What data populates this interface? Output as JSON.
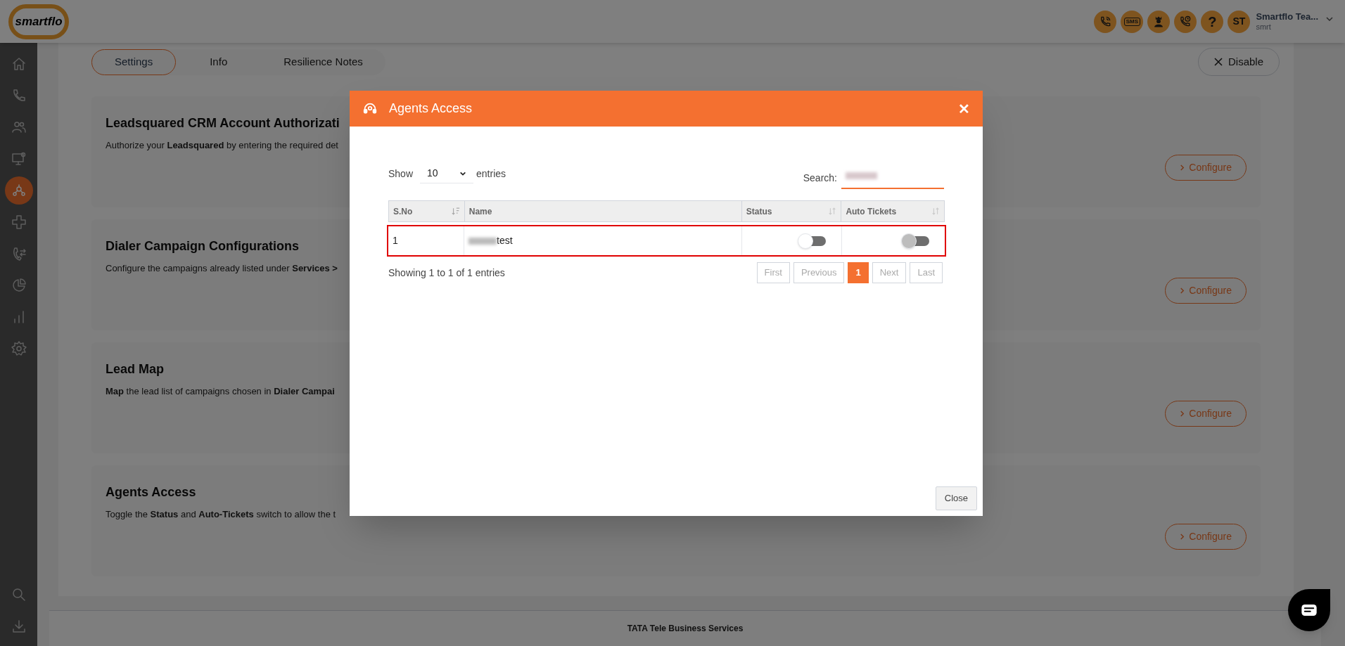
{
  "header": {
    "logo": "smartflo",
    "action_buttons": [
      {
        "kind": "phone"
      },
      {
        "kind": "sms",
        "label": "SMS"
      },
      {
        "kind": "agent"
      },
      {
        "kind": "phone-clock"
      },
      {
        "kind": "help",
        "label": "?"
      }
    ],
    "user": {
      "initials": "ST",
      "name": "Smartflo Tea...",
      "org": "smrt"
    }
  },
  "sidebar": {
    "items": [
      {
        "selected": false
      },
      {
        "selected": false
      },
      {
        "selected": false
      },
      {
        "selected": false
      },
      {
        "selected": true
      },
      {
        "selected": false
      },
      {
        "selected": false
      },
      {
        "selected": false
      },
      {
        "selected": false
      },
      {
        "selected": false
      }
    ],
    "bottom_items": [
      {
        "selected": false
      },
      {
        "selected": false
      }
    ]
  },
  "tabs": [
    {
      "label": "Settings",
      "selected": true
    },
    {
      "label": "Info",
      "selected": false
    },
    {
      "label": "Resilience Notes",
      "selected": false
    }
  ],
  "disable_button": "Disable",
  "cards": [
    {
      "title": "Leadsquared CRM Account Authorizati",
      "description": "Authorize your **Leadsquared** by entering the required det",
      "button": "Configure"
    },
    {
      "title": "Dialer Campaign Configurations",
      "description": "Configure the campaigns already listed under **Services >**",
      "button": "Configure"
    },
    {
      "title": "Lead Map",
      "description": "**Map** the lead list of campaigns chosen in **Dialer Campai**",
      "button": "Configure"
    },
    {
      "title": "Agents Access",
      "description": "Toggle the **Status** and **Auto-Tickets** switch to allow the t",
      "button": "Configure"
    }
  ],
  "footer": "TATA Tele Business Services",
  "modal": {
    "title": "Agents Access",
    "close_icon": "✕",
    "show_label": "Show",
    "page_size": "10",
    "entries_label": "entries",
    "search_label": "Search:",
    "table": {
      "columns": [
        "S.No",
        "Name",
        "Status",
        "Auto Tickets"
      ],
      "rows": [
        {
          "sno": "1",
          "name": "test",
          "status": {
            "on": false,
            "disabled": false
          },
          "auto_tickets": {
            "on": false,
            "disabled": true
          },
          "selected": true
        }
      ]
    },
    "info": "Showing 1 to 1 of 1 entries",
    "pagination": [
      {
        "label": "First",
        "selected": false
      },
      {
        "label": "Previous",
        "selected": false
      },
      {
        "label": "1",
        "selected": true
      },
      {
        "label": "Next",
        "selected": false
      },
      {
        "label": "Last",
        "selected": false
      }
    ],
    "close_button": "Close"
  }
}
